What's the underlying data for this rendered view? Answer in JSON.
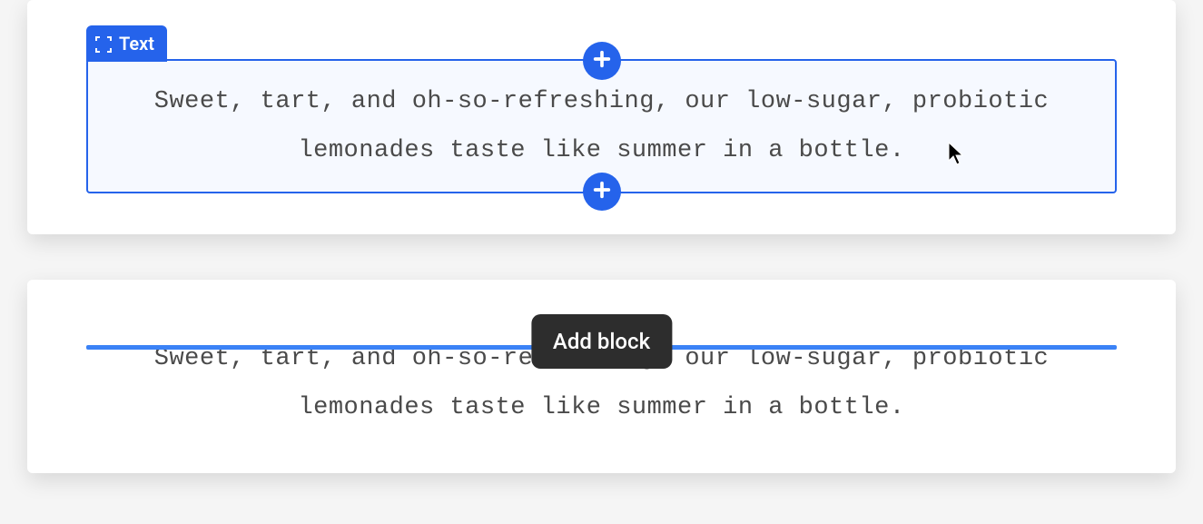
{
  "blocks": {
    "label": "Text",
    "content1": "Sweet, tart, and oh-so-refreshing, our low-sugar, probiotic lemonades taste like summer in a bottle.",
    "content2": "Sweet, tart, and oh-so-refreshing, our low-sugar, probiotic lemonades taste like summer in a bottle."
  },
  "tooltip": {
    "add_block": "Add block"
  },
  "colors": {
    "accent": "#2563eb",
    "tooltip_bg": "#2d2d2d"
  }
}
